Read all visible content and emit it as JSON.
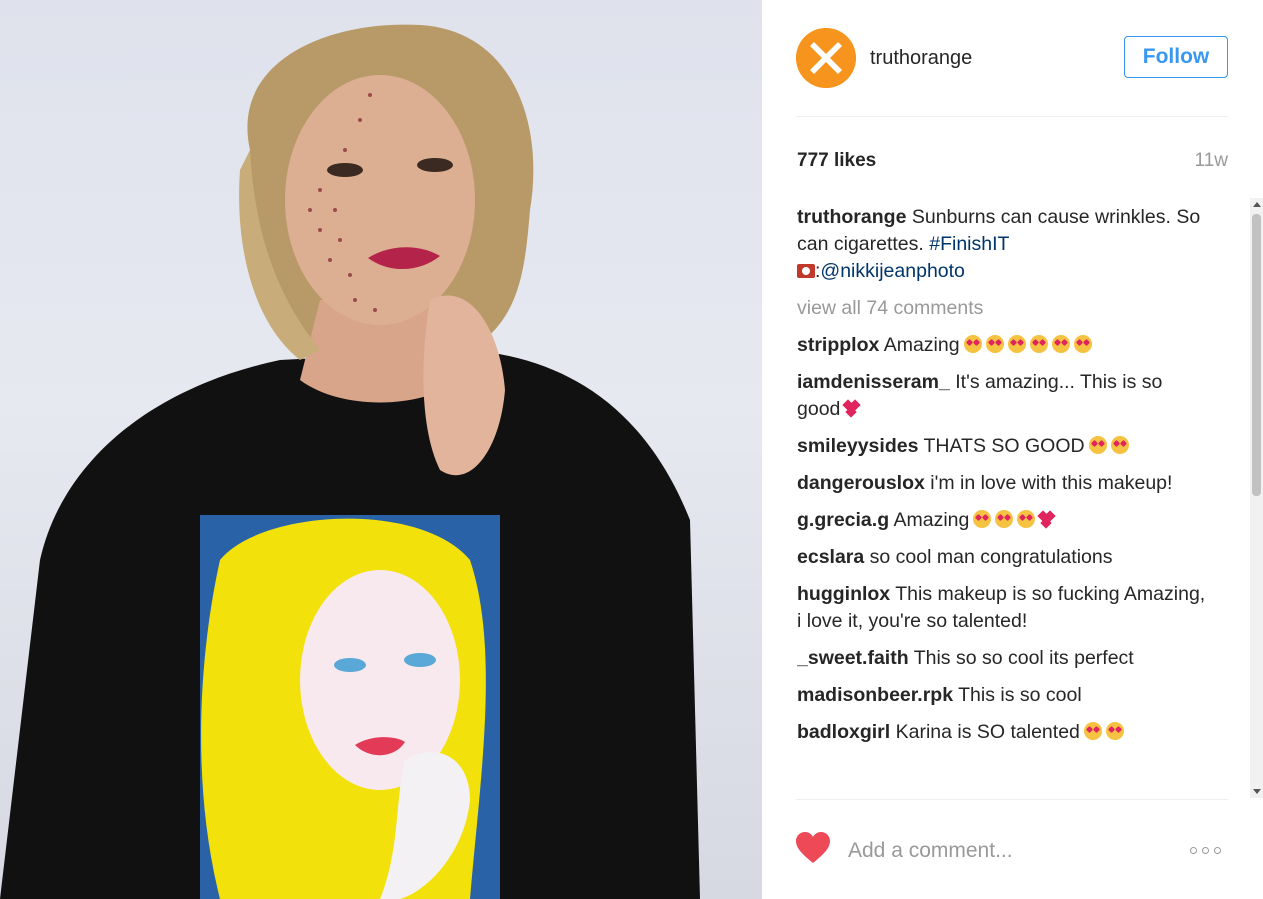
{
  "post": {
    "username": "truthorange",
    "follow_label": "Follow",
    "likes": "777 likes",
    "age": "11w"
  },
  "caption": {
    "username": "truthorange",
    "text": "Sunburns can cause wrinkles. So can cigarettes.",
    "hashtag": "#FinishIT",
    "credit_prefix": ":",
    "credit": "@nikkijeanphoto"
  },
  "view_all": "view all 74 comments",
  "comments": [
    {
      "user": "stripplox",
      "text": "Amazing",
      "emoji": 6
    },
    {
      "user": "iamdenisseram_",
      "text": "It's amazing... This is so good",
      "hearts": true
    },
    {
      "user": "smileyysides",
      "text": "THATS SO GOOD",
      "emoji": 2
    },
    {
      "user": "dangerouslox",
      "text": "i'm in love with this makeup!"
    },
    {
      "user": "g.grecia.g",
      "text": "Amazing",
      "emoji": 3,
      "hearts": true
    },
    {
      "user": "ecslara",
      "text": "so cool man congratulations"
    },
    {
      "user": "hugginlox",
      "text": "This makeup is so fucking Amazing, i love it, you're so talented!"
    },
    {
      "user": "_sweet.faith",
      "text": "This so so cool its perfect"
    },
    {
      "user": "madisonbeer.rpk",
      "text": "This is so cool"
    },
    {
      "user": "badloxgirl",
      "text": "Karina is SO talented",
      "emoji": 2
    }
  ],
  "comment_box": {
    "placeholder": "Add a comment..."
  },
  "colors": {
    "accent": "#3897f0",
    "like": "#ed4956",
    "brand": "#f7941d",
    "hashtag": "#003569"
  }
}
